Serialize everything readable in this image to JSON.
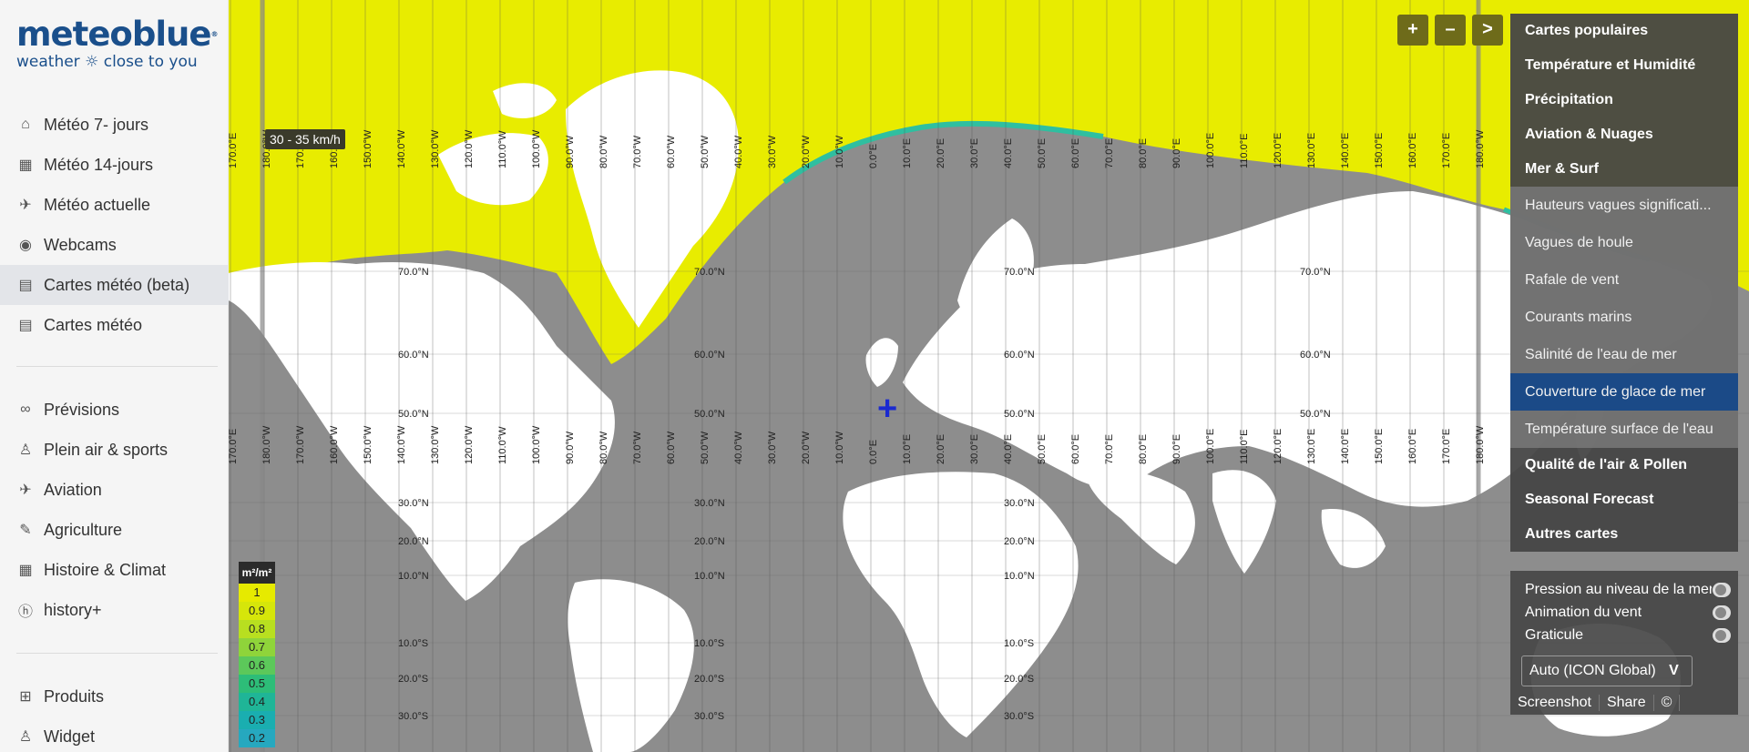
{
  "logo": {
    "name": "meteoblue",
    "tagline": "weather ☼ close to you"
  },
  "nav_primary": [
    {
      "label": "Météo 7- jours",
      "icon": "home-icon"
    },
    {
      "label": "Météo 14-jours",
      "icon": "calendar-14-icon"
    },
    {
      "label": "Météo actuelle",
      "icon": "satellite-icon"
    },
    {
      "label": "Webcams",
      "icon": "webcam-icon"
    },
    {
      "label": "Cartes météo (beta)",
      "icon": "map-icon",
      "active": true
    },
    {
      "label": "Cartes météo",
      "icon": "map-icon"
    }
  ],
  "nav_secondary": [
    {
      "label": "Prévisions",
      "icon": "binoculars-icon"
    },
    {
      "label": "Plein air & sports",
      "icon": "hiker-icon"
    },
    {
      "label": "Aviation",
      "icon": "plane-icon"
    },
    {
      "label": "Agriculture",
      "icon": "agriculture-icon"
    },
    {
      "label": "Histoire & Climat",
      "icon": "table-icon"
    },
    {
      "label": "history+",
      "icon": "history-plus-icon"
    }
  ],
  "nav_tertiary": [
    {
      "label": "Produits",
      "icon": "cart-icon"
    },
    {
      "label": "Widget",
      "icon": "widget-icon"
    }
  ],
  "map": {
    "wind_tooltip": "30 - 35 km/h",
    "zoom_in": "+",
    "zoom_out": "–",
    "collapse": ">",
    "longitude_labels": [
      "170.0°E",
      "180.0°W",
      "170.0°W",
      "160.0°W",
      "150.0°W",
      "140.0°W",
      "130.0°W",
      "120.0°W",
      "110.0°W",
      "100.0°W",
      "90.0°W",
      "80.0°W",
      "70.0°W",
      "60.0°W",
      "50.0°W",
      "40.0°W",
      "30.0°W",
      "20.0°W",
      "10.0°W",
      "0.0°E",
      "10.0°E",
      "20.0°E",
      "30.0°E",
      "40.0°E",
      "50.0°E",
      "60.0°E",
      "70.0°E",
      "80.0°E",
      "90.0°E",
      "100.0°E",
      "110.0°E",
      "120.0°E",
      "130.0°E",
      "140.0°E",
      "150.0°E",
      "160.0°E",
      "170.0°E",
      "180.0°W"
    ],
    "latitude_labels": [
      "70.0°N",
      "60.0°N",
      "50.0°N",
      "30.0°N",
      "20.0°N",
      "10.0°N",
      "10.0°S",
      "20.0°S",
      "30.0°S"
    ]
  },
  "legend": {
    "unit": "m²/m²",
    "values": [
      "1",
      "0.9",
      "0.8",
      "0.7",
      "0.6",
      "0.5",
      "0.4",
      "0.3",
      "0.2"
    ],
    "colors": [
      "#e6ea00",
      "#d6e60a",
      "#b8df20",
      "#8fd43a",
      "#5cc85a",
      "#2dbd78",
      "#1fb597",
      "#1aaeb0",
      "#26a8bf"
    ]
  },
  "menu": {
    "categories_top": [
      "Cartes populaires",
      "Température et Humidité",
      "Précipitation",
      "Aviation & Nuages",
      "Mer & Surf"
    ],
    "sub_items": [
      "Hauteurs vagues significati...",
      "Vagues de houle",
      "Rafale de vent",
      "Courants marins",
      "Salinité de l'eau de mer",
      "Couverture de glace de mer",
      "Température surface de l'eau"
    ],
    "selected_sub": "Couverture de glace de mer",
    "categories_bottom": [
      "Qualité de l'air & Pollen",
      "Seasonal Forecast",
      "Autres cartes"
    ]
  },
  "options": {
    "toggles": [
      "Pression au niveau de la mer",
      "Animation du vent",
      "Graticule"
    ],
    "model": "Auto (ICON Global)",
    "model_chevron": "V",
    "footer": [
      "Screenshot",
      "Share",
      "©"
    ]
  },
  "colors": {
    "ice": "#e8ec00",
    "ocean": "#8d8d8d",
    "land": "#ffffff",
    "brand": "#1a4f8b",
    "selected": "#1b4a87"
  }
}
